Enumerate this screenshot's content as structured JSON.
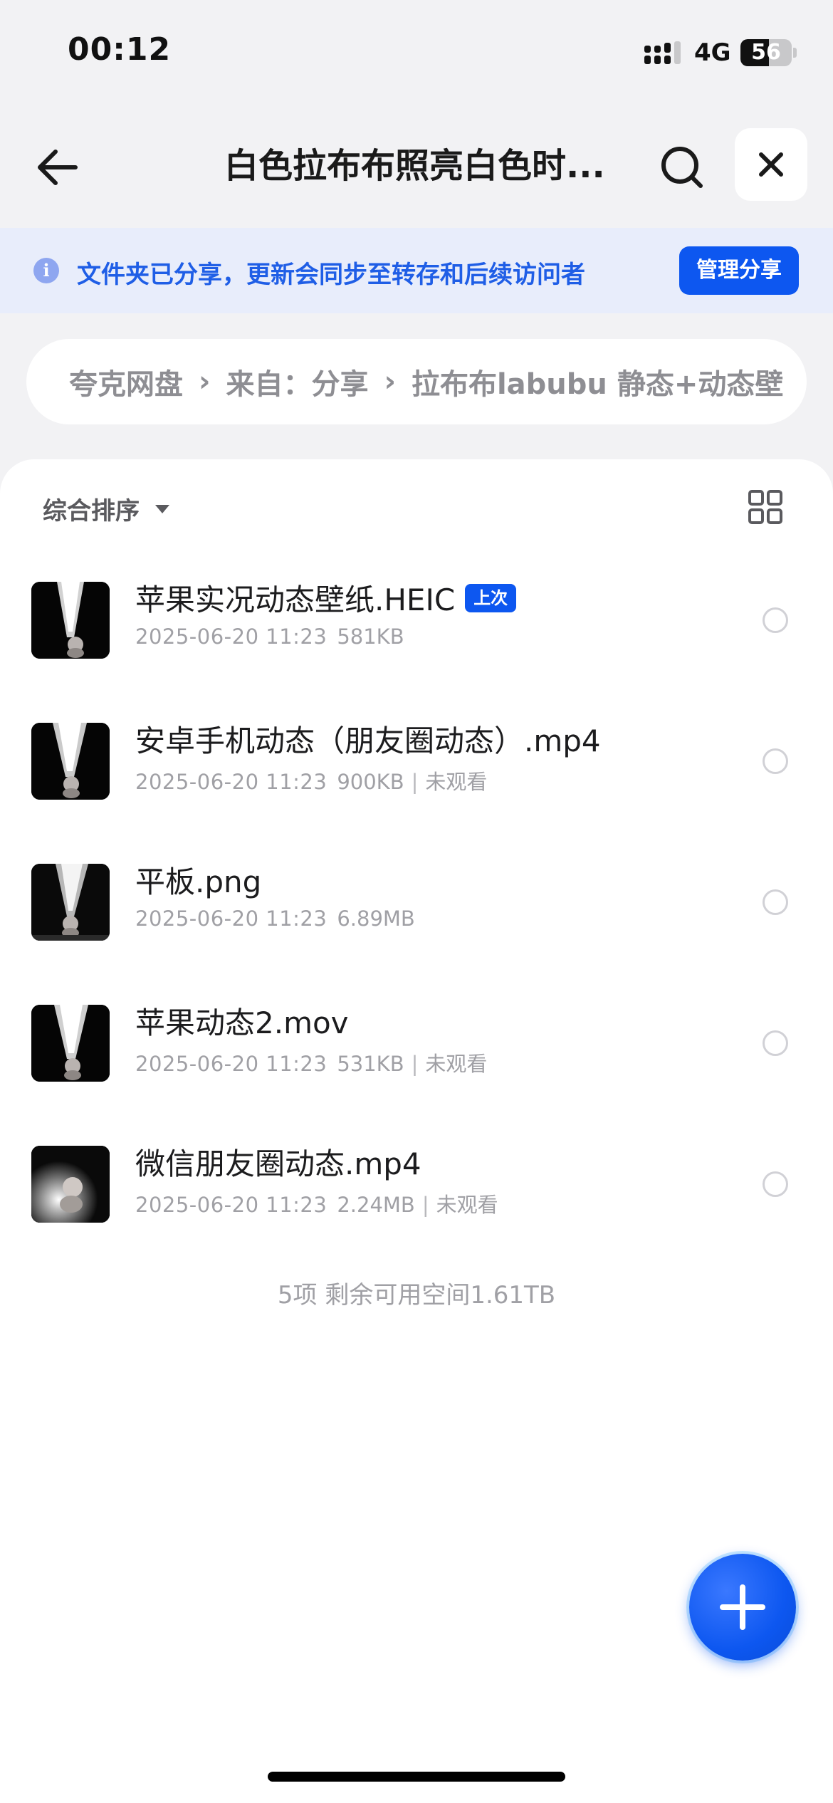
{
  "status_bar": {
    "time": "00:12",
    "network": "4G",
    "battery_level": "56",
    "battery_fraction": 0.56
  },
  "nav": {
    "title": "白色拉布布照亮白色时...",
    "back_icon": "arrow-left-icon",
    "search_icon": "search-icon",
    "close_icon": "close-icon"
  },
  "share_banner": {
    "text": "文件夹已分享，更新会同步至转存和后续访问者",
    "button_label": "管理分享",
    "info_icon": "i",
    "accent_color": "#0d57f0"
  },
  "breadcrumb": {
    "items": [
      "夸克网盘",
      "来自：分享",
      "拉布布labubu 静态+动态壁"
    ],
    "separator": "›"
  },
  "sort": {
    "label": "综合排序",
    "view_icon": "grid-view-icon"
  },
  "files": [
    {
      "name": "苹果实况动态壁纸.HEIC",
      "date": "2025-06-20 11:23",
      "size": "581KB",
      "badge": "上次",
      "status": ""
    },
    {
      "name": "安卓手机动态（朋友圈动态）.mp4",
      "date": "2025-06-20 11:23",
      "size": "900KB",
      "badge": "",
      "status": "未观看"
    },
    {
      "name": "平板.png",
      "date": "2025-06-20 11:23",
      "size": "6.89MB",
      "badge": "",
      "status": ""
    },
    {
      "name": "苹果动态2.mov",
      "date": "2025-06-20 11:23",
      "size": "531KB",
      "badge": "",
      "status": "未观看"
    },
    {
      "name": "微信朋友圈动态.mp4",
      "date": "2025-06-20 11:23",
      "size": "2.24MB",
      "badge": "",
      "status": "未观看"
    }
  ],
  "footer": {
    "summary": "5项 剩余可用空间1.61TB"
  },
  "fab": {
    "icon": "plus-icon"
  }
}
